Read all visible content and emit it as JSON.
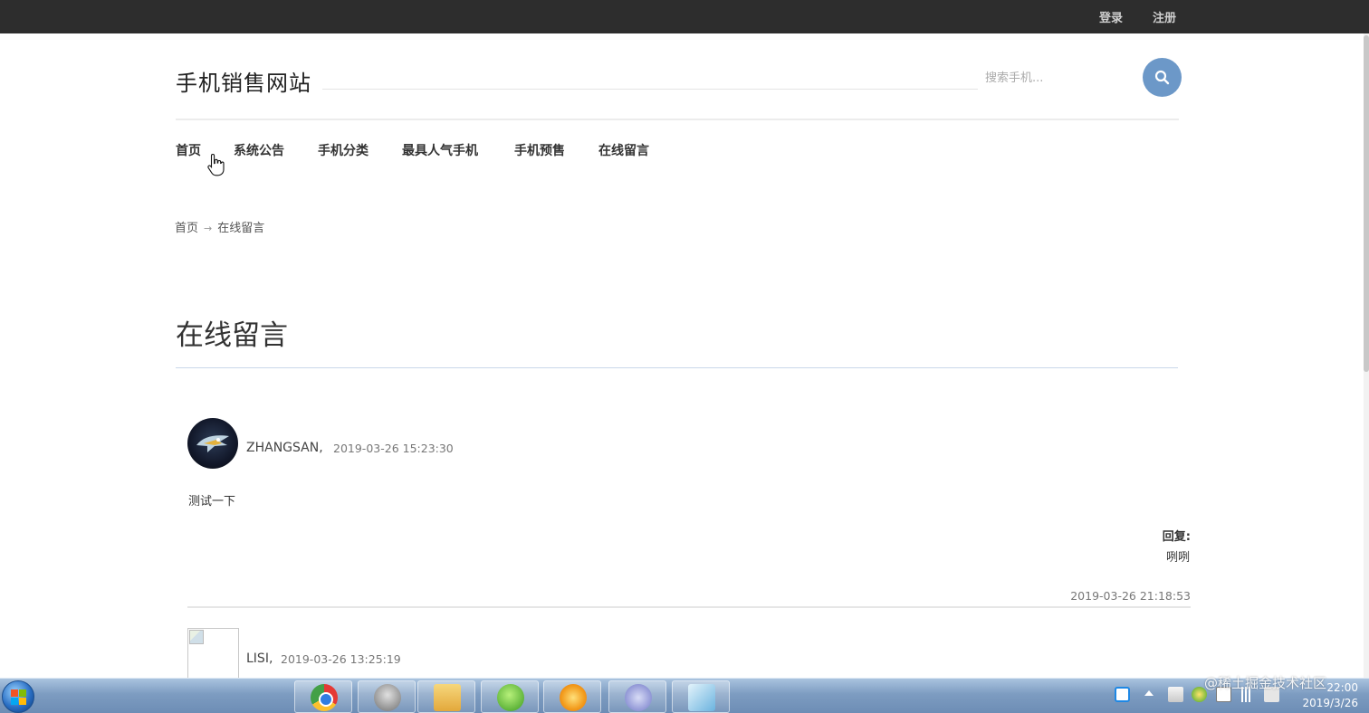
{
  "topbar": {
    "login": "登录",
    "register": "注册"
  },
  "header": {
    "site_title": "手机销售网站",
    "search_placeholder": "搜索手机..."
  },
  "nav": {
    "items": [
      {
        "label": "首页"
      },
      {
        "label": "系统公告"
      },
      {
        "label": "手机分类"
      },
      {
        "label": "最具人气手机"
      },
      {
        "label": "手机预售"
      },
      {
        "label": "在线留言"
      }
    ]
  },
  "breadcrumb": {
    "home": "首页",
    "separator": "→",
    "current": "在线留言"
  },
  "page": {
    "title": "在线留言"
  },
  "comments": [
    {
      "author": "ZHANGSAN,",
      "date": "2019-03-26 15:23:30",
      "body": "测试一下",
      "reply_label": "回复:",
      "reply_text": "咧咧",
      "reply_date": "2019-03-26 21:18:53"
    },
    {
      "author": "LISI,",
      "date": "2019-03-26 13:25:19"
    }
  ],
  "taskbar": {
    "apps": [
      "chrome-icon",
      "tools-icon",
      "folder-icon",
      "green-app-icon",
      "player-icon",
      "eclipse-icon",
      "blue-app-icon"
    ],
    "clock_time": "22:00",
    "clock_date": "2019/3/26",
    "watermark": "@稀土掘金技术社区"
  },
  "colors": {
    "topbar_bg": "#2d2d2d",
    "search_button": "#6c98c8",
    "page_rule": "#c9d8ea"
  }
}
